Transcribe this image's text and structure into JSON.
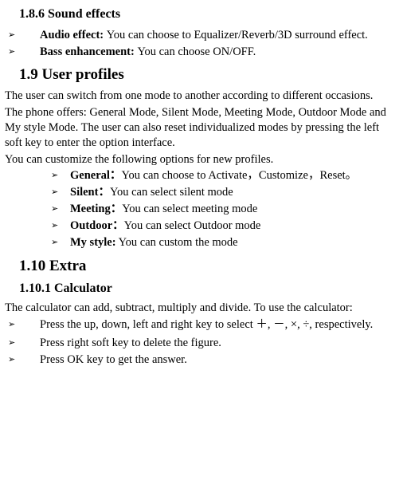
{
  "sec186": {
    "heading": "1.8.6     Sound effects",
    "items": [
      {
        "bold": "Audio effect: ",
        "text": "You can choose to Equalizer/Reverb/3D surround effect."
      },
      {
        "bold": "Bass enhancement: ",
        "text": "You can choose ON/OFF."
      }
    ]
  },
  "sec19": {
    "heading": "1.9   User profiles",
    "p1": "The user can switch from one mode to another according to different occasions.",
    "p2": "The phone offers: General Mode, Silent Mode, Meeting Mode, Outdoor Mode and My style Mode. The user can also reset individualized modes by pressing the left soft key to enter the option interface.",
    "p3": "You can customize the following options for new profiles.",
    "items": [
      {
        "bold": "General：",
        "text": "You can choose to Activate，Customize，Reset。"
      },
      {
        "bold": "Silent：",
        "text": "You can select silent mode"
      },
      {
        "bold": "Meeting：",
        "text": "You can select meeting mode"
      },
      {
        "bold": "Outdoor：",
        "text": "You can select Outdoor mode"
      },
      {
        "bold": "My style:",
        "text": "    You can custom the mode"
      }
    ]
  },
  "sec110": {
    "heading": "1.10 Extra"
  },
  "sec1101": {
    "heading": "1.10.1  Calculator",
    "p1": "The calculator can add, subtract, multiply and divide. To use the calculator:",
    "items": [
      {
        "text": "Press the up, down, left and right key to select ＋, －, ×, ÷, respectively."
      },
      {
        "text": "Press right soft key to delete the figure."
      },
      {
        "text": "Press OK key to get the answer."
      }
    ]
  },
  "arrow": "➢"
}
